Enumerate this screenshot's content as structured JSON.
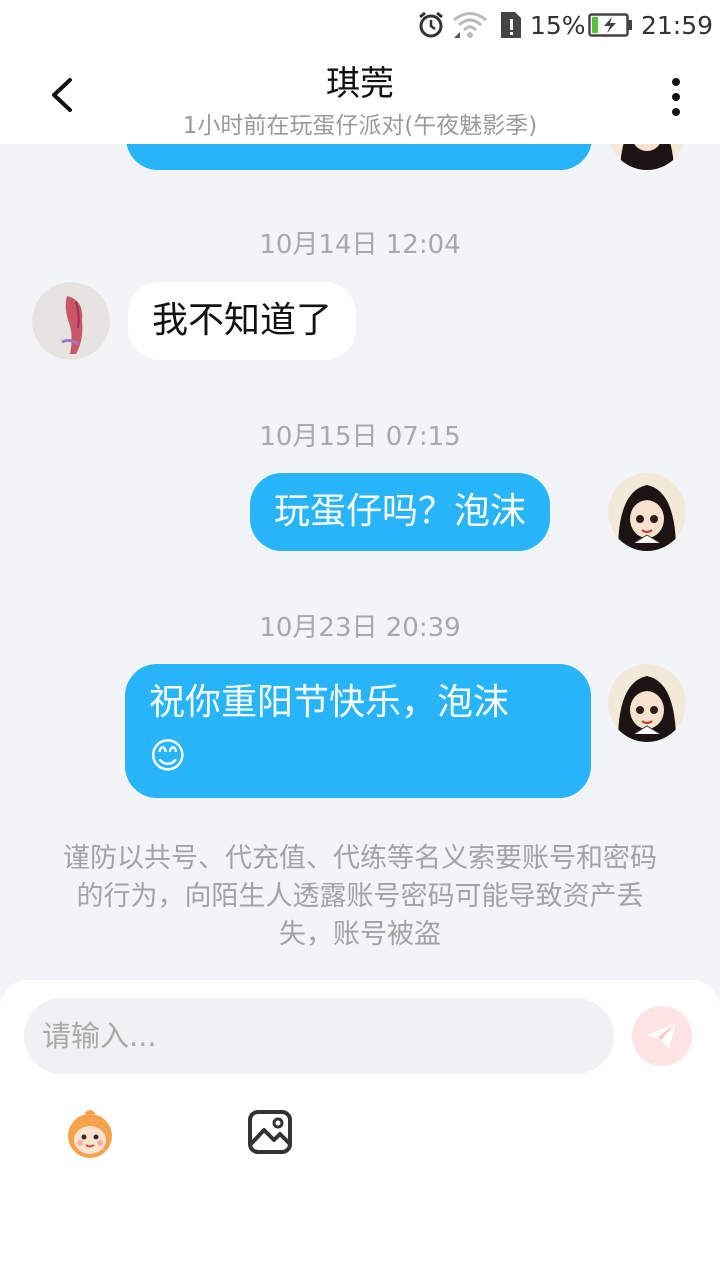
{
  "status_bar": {
    "battery_percent": "15%",
    "time": "21:59"
  },
  "header": {
    "title": "琪莞",
    "subtitle": "1小时前在玩蛋仔派对(午夜魅影季)"
  },
  "messages": [
    {
      "type": "timestamp",
      "text": "10月14日 12:04"
    },
    {
      "type": "incoming",
      "text": "我不知道了"
    },
    {
      "type": "timestamp",
      "text": "10月15日 07:15"
    },
    {
      "type": "outgoing",
      "text": "玩蛋仔吗？泡沫"
    },
    {
      "type": "timestamp",
      "text": "10月23日 20:39"
    },
    {
      "type": "outgoing",
      "text": "祝你重阳节快乐，泡沫",
      "emoji": "😊"
    }
  ],
  "warning_text": "谨防以共号、代充值、代练等名义索要账号和密码的行为，向陌生人透露账号密码可能导致资产丢失，账号被盗",
  "composer": {
    "placeholder": "请输入..."
  },
  "colors": {
    "outgoing_bubble": "#27b4f8",
    "incoming_bubble": "#ffffff",
    "background": "#f2f4f7",
    "send_button": "#fde3e3"
  }
}
